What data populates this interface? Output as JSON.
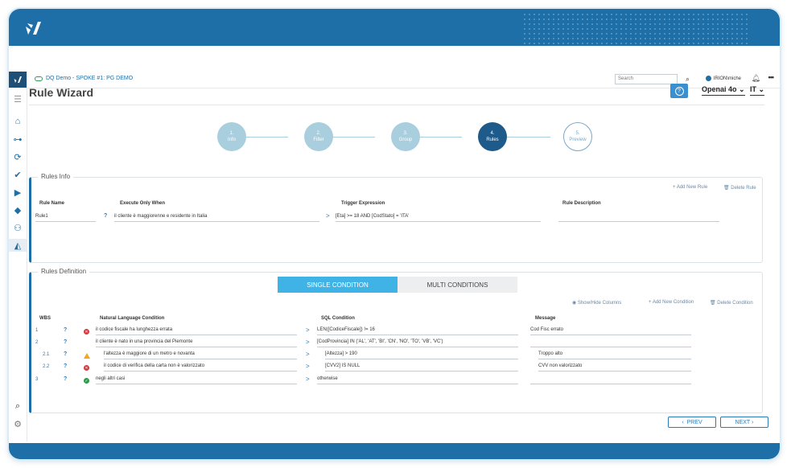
{
  "app": {
    "breadcrumb": "DQ Demo - SPOKE #1: PG DEMO",
    "search_placeholder": "Search",
    "user": "IRION\\miche"
  },
  "page": {
    "title": "Rule Wizard",
    "model_select": "Openai 4o",
    "lang_select": "IT"
  },
  "steps": [
    {
      "num": "1.",
      "label": "Info",
      "state": "done"
    },
    {
      "num": "2.",
      "label": "Filter",
      "state": "done"
    },
    {
      "num": "3.",
      "label": "Group",
      "state": "done"
    },
    {
      "num": "4.",
      "label": "Rules",
      "state": "current"
    },
    {
      "num": "5.",
      "label": "Preview",
      "state": "next"
    }
  ],
  "rules_info": {
    "legend": "Rules Info",
    "add_label": "+ Add New Rule",
    "delete_label": "Delete Rule",
    "headers": {
      "rule_name": "Rule Name",
      "execute": "Execute Only When",
      "trigger": "Trigger Expression",
      "description": "Rule Description"
    },
    "row": {
      "rule_name": "Rule1",
      "execute": "il cliente è maggiorenne e residente in Italia",
      "trigger": "[Eta] >= 18 AND [CodStato] = 'ITA'",
      "description": ""
    }
  },
  "rules_def": {
    "legend": "Rules Definition",
    "tab_single": "SINGLE CONDITION",
    "tab_multi": "MULTI CONDITIONS",
    "show_hide": "Show/Hide Columns",
    "add_condition": "+ Add New Condition",
    "delete_condition": "Delete Condition",
    "headers": {
      "wbs": "WBS",
      "nl": "Natural Language Condition",
      "sql": "SQL Condition",
      "msg": "Message"
    },
    "rows": [
      {
        "wbs": "1",
        "status": "err",
        "nl": "il codice fiscale ha lunghezza errata",
        "sql": "LEN([CodiceFiscale]) != 16",
        "msg": "Cod Fisc errato",
        "indent": 0
      },
      {
        "wbs": "2",
        "status": "",
        "nl": "il cliente è nato in una provincia del Piemonte",
        "sql": "[CodProvincia] IN ('AL', 'AT', 'BI', 'CN', 'NO', 'TO', 'VB', 'VC')",
        "msg": "",
        "indent": 0
      },
      {
        "wbs": "2.1",
        "status": "warn",
        "nl": "l'altezza è maggiore di un metro e novanta",
        "sql": "[Altezza] > 190",
        "msg": "Troppo alto",
        "indent": 1
      },
      {
        "wbs": "2.2",
        "status": "err",
        "nl": "il codice di verifica della carta non è valorizzato",
        "sql": "[CVV2] IS NULL",
        "msg": "CVV non valorizzato",
        "indent": 1
      },
      {
        "wbs": "3",
        "status": "ok",
        "nl": "negli altri casi",
        "sql": "otherwise",
        "msg": "",
        "indent": 0
      }
    ]
  },
  "nav": {
    "prev": "PREV",
    "next": "NEXT"
  },
  "colors": {
    "brand": "#1e6fa8",
    "accent": "#3fb3e6",
    "error": "#d9363e",
    "warning": "#f2a81d",
    "success": "#2d9a46"
  }
}
